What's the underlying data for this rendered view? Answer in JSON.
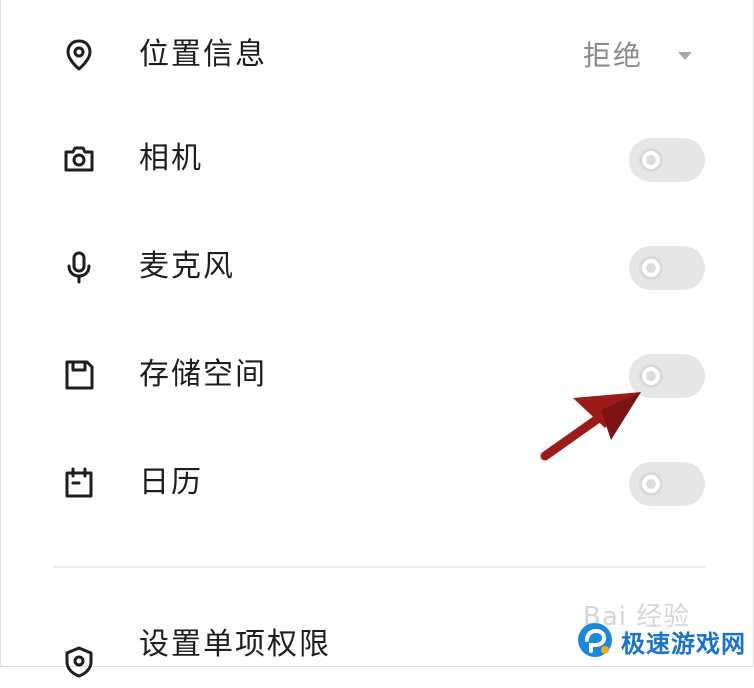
{
  "permissions": [
    {
      "label": "位置信息",
      "icon": "location-pin-icon",
      "control": "dropdown",
      "value": "拒绝"
    },
    {
      "label": "相机",
      "icon": "camera-icon",
      "control": "toggle",
      "enabled": false
    },
    {
      "label": "麦克风",
      "icon": "microphone-icon",
      "control": "toggle",
      "enabled": false
    },
    {
      "label": "存储空间",
      "icon": "storage-icon",
      "control": "toggle",
      "enabled": false
    },
    {
      "label": "日历",
      "icon": "calendar-icon",
      "control": "toggle",
      "enabled": false
    }
  ],
  "section": {
    "label": "设置单项权限",
    "icon": "shield-icon"
  },
  "watermark": {
    "faint": "Bai 经验",
    "brand": "极速游戏网"
  },
  "colors": {
    "toggle_off": "#e6e6e6",
    "dropdown_text": "#8a8a8a",
    "arrow": "#9b1b1b",
    "brand": "#1a73c9"
  }
}
